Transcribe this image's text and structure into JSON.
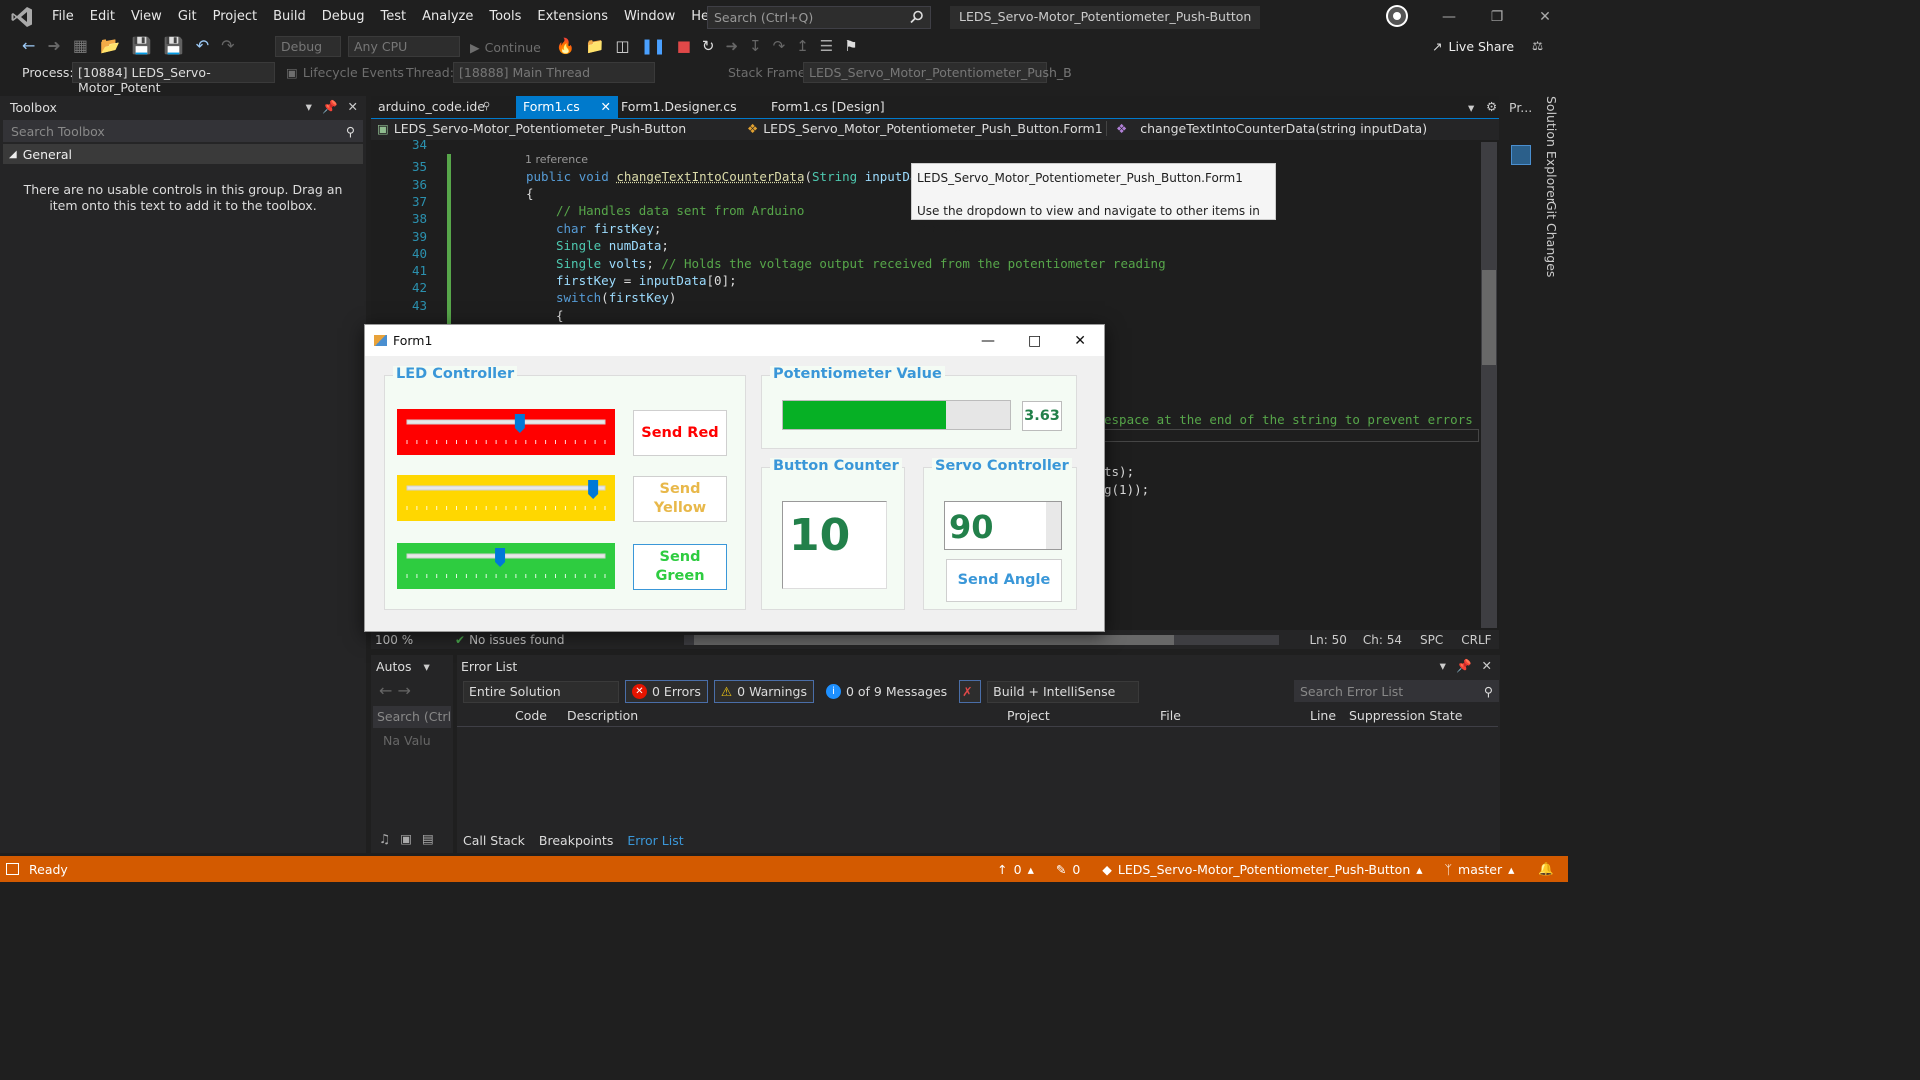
{
  "menu": [
    "File",
    "Edit",
    "View",
    "Git",
    "Project",
    "Build",
    "Debug",
    "Test",
    "Analyze",
    "Tools",
    "Extensions",
    "Window",
    "Help"
  ],
  "search_placeholder": "Search (Ctrl+Q)",
  "solution_title": "LEDS_Servo-Motor_Potentiometer_Push-Button",
  "toolbar": {
    "config": "Debug",
    "platform": "Any CPU",
    "continue": "Continue",
    "live_share": "Live Share"
  },
  "toolbar2": {
    "process_label": "Process:",
    "process_value": "[10884] LEDS_Servo-Motor_Potent",
    "lifecycle": "Lifecycle Events",
    "thread_label": "Thread:",
    "thread_value": "[18888] Main Thread",
    "stack_label": "Stack Frame:",
    "stack_value": "LEDS_Servo_Motor_Potentiometer_Push_B"
  },
  "toolbox": {
    "title": "Toolbox",
    "search": "Search Toolbox",
    "group": "General",
    "empty_msg": "There are no usable controls in this group. Drag an item onto this text to add it to the toolbox."
  },
  "tabs": [
    "arduino_code.ide",
    "Form1.cs",
    "Form1.Designer.cs",
    "Form1.cs [Design]"
  ],
  "nav": {
    "project": "LEDS_Servo-Motor_Potentiometer_Push-Button",
    "class": "LEDS_Servo_Motor_Potentiometer_Push_Button.Form1",
    "member": "changeTextIntoCounterData(string inputData)"
  },
  "side_tab": "Pr...",
  "tooltip": {
    "line1": "LEDS_Servo_Motor_Potentiometer_Push_Button.Form1",
    "line2": "Use the dropdown to view and navigate to other items in this file."
  },
  "code": {
    "line_numbers": [
      "34",
      "35",
      "36",
      "37",
      "38",
      "39",
      "40",
      "41",
      "42",
      "43"
    ],
    "reference": "1 reference",
    "hidden_tail1": "espace at the end of the string to prevent errors",
    "hidden_tail2": "ts);",
    "hidden_tail3": "g(1));"
  },
  "form1": {
    "title": "Form1",
    "led_group": "LED Controller",
    "pot_group": "Potentiometer Value",
    "counter_group": "Button Counter",
    "servo_group": "Servo Controller",
    "send_red": "Send Red",
    "send_yellow": "Send\nYellow",
    "send_green": "Send\nGreen",
    "pot_value": "3.63",
    "pot_fraction": 0.72,
    "slider_red": 0.57,
    "slider_yellow": 0.94,
    "slider_green": 0.47,
    "counter_value": "10",
    "servo_value": "90",
    "send_angle": "Send Angle",
    "colors": {
      "red": "#ff0000",
      "yellow": "#ffd700",
      "green": "#2ecc40",
      "accent": "#3a97d8",
      "text_green": "#22804a"
    }
  },
  "editor_status": {
    "zoom": "100 %",
    "issues": "No issues found",
    "ln": "Ln: 50",
    "ch": "Ch: 54",
    "spc": "SPC",
    "crlf": "CRLF"
  },
  "autos": {
    "title": "Autos",
    "search": "Search (Ctrl",
    "col": "Na Valu"
  },
  "errorlist": {
    "title": "Error List",
    "scope": "Entire Solution",
    "errors": "0 Errors",
    "warnings": "0 Warnings",
    "messages": "0 of 9 Messages",
    "build": "Build + IntelliSense",
    "search": "Search Error List",
    "cols": [
      "Code",
      "Description",
      "Project",
      "File",
      "Line",
      "Suppression State"
    ]
  },
  "bottom_tabs": [
    "Call Stack",
    "Breakpoints",
    "Error List"
  ],
  "right_tabs": [
    "Solution Explorer",
    "Git Changes"
  ],
  "status": {
    "ready": "Ready",
    "up": "0",
    "edits": "0",
    "repo": "LEDS_Servo-Motor_Potentiometer_Push-Button",
    "branch": "master"
  }
}
